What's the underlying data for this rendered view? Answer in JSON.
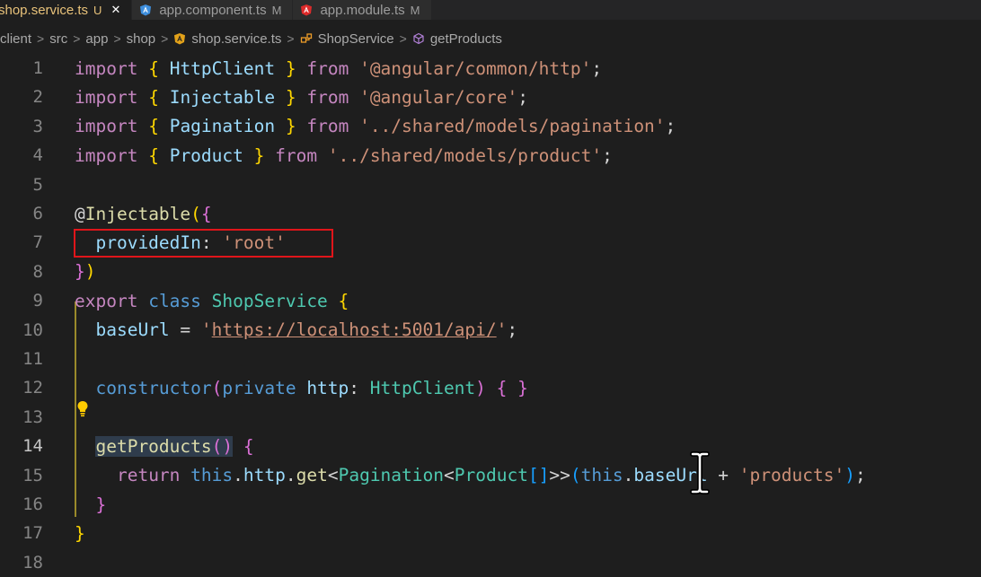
{
  "tabs": [
    {
      "label": "shop.service.ts",
      "status": "U",
      "active": true,
      "icon": "angular-service-icon"
    },
    {
      "label": "app.component.ts",
      "status": "M",
      "active": false,
      "icon": "angular-component-icon"
    },
    {
      "label": "app.module.ts",
      "status": "M",
      "active": false,
      "icon": "angular-module-icon"
    }
  ],
  "breadcrumb": {
    "items": [
      "client",
      "src",
      "app",
      "shop",
      "shop.service.ts",
      "ShopService",
      "getProducts"
    ]
  },
  "editor": {
    "current_line": 14,
    "lines": [
      {
        "n": "1",
        "tokens": [
          [
            "kwc",
            "import"
          ],
          [
            "t",
            " "
          ],
          [
            "br1",
            "{"
          ],
          [
            "t",
            " "
          ],
          [
            "var",
            "HttpClient"
          ],
          [
            "t",
            " "
          ],
          [
            "br1",
            "}"
          ],
          [
            "t",
            " "
          ],
          [
            "kwc",
            "from"
          ],
          [
            "t",
            " "
          ],
          [
            "str",
            "'@angular/common/http'"
          ],
          [
            "t",
            ";"
          ]
        ]
      },
      {
        "n": "2",
        "tokens": [
          [
            "kwc",
            "import"
          ],
          [
            "t",
            " "
          ],
          [
            "br1",
            "{"
          ],
          [
            "t",
            " "
          ],
          [
            "var",
            "Injectable"
          ],
          [
            "t",
            " "
          ],
          [
            "br1",
            "}"
          ],
          [
            "t",
            " "
          ],
          [
            "kwc",
            "from"
          ],
          [
            "t",
            " "
          ],
          [
            "str",
            "'@angular/core'"
          ],
          [
            "t",
            ";"
          ]
        ]
      },
      {
        "n": "3",
        "tokens": [
          [
            "kwc",
            "import"
          ],
          [
            "t",
            " "
          ],
          [
            "br1",
            "{"
          ],
          [
            "t",
            " "
          ],
          [
            "var",
            "Pagination"
          ],
          [
            "t",
            " "
          ],
          [
            "br1",
            "}"
          ],
          [
            "t",
            " "
          ],
          [
            "kwc",
            "from"
          ],
          [
            "t",
            " "
          ],
          [
            "str",
            "'../shared/models/pagination'"
          ],
          [
            "t",
            ";"
          ]
        ]
      },
      {
        "n": "4",
        "tokens": [
          [
            "kwc",
            "import"
          ],
          [
            "t",
            " "
          ],
          [
            "br1",
            "{"
          ],
          [
            "t",
            " "
          ],
          [
            "var",
            "Product"
          ],
          [
            "t",
            " "
          ],
          [
            "br1",
            "}"
          ],
          [
            "t",
            " "
          ],
          [
            "kwc",
            "from"
          ],
          [
            "t",
            " "
          ],
          [
            "str",
            "'../shared/models/product'"
          ],
          [
            "t",
            ";"
          ]
        ]
      },
      {
        "n": "5",
        "tokens": []
      },
      {
        "n": "6",
        "tokens": [
          [
            "t",
            "@"
          ],
          [
            "fn",
            "Injectable"
          ],
          [
            "br1",
            "("
          ],
          [
            "br2",
            "{"
          ]
        ]
      },
      {
        "n": "7",
        "tokens": [
          [
            "t",
            "  "
          ],
          [
            "var",
            "providedIn"
          ],
          [
            "t",
            ": "
          ],
          [
            "str",
            "'root'"
          ]
        ]
      },
      {
        "n": "8",
        "tokens": [
          [
            "br2",
            "}"
          ],
          [
            "br1",
            ")"
          ]
        ]
      },
      {
        "n": "9",
        "tokens": [
          [
            "kwc",
            "export"
          ],
          [
            "t",
            " "
          ],
          [
            "kw",
            "class"
          ],
          [
            "t",
            " "
          ],
          [
            "cls",
            "ShopService"
          ],
          [
            "t",
            " "
          ],
          [
            "br1",
            "{"
          ]
        ]
      },
      {
        "n": "10",
        "tokens": [
          [
            "t",
            "  "
          ],
          [
            "var",
            "baseUrl"
          ],
          [
            "t",
            " = "
          ],
          [
            "str",
            "'"
          ],
          [
            "strlink",
            "https://localhost:5001/api/"
          ],
          [
            "str",
            "'"
          ],
          [
            "t",
            ";"
          ]
        ]
      },
      {
        "n": "11",
        "tokens": []
      },
      {
        "n": "12",
        "tokens": [
          [
            "t",
            "  "
          ],
          [
            "kw",
            "constructor"
          ],
          [
            "br2",
            "("
          ],
          [
            "kw",
            "private"
          ],
          [
            "t",
            " "
          ],
          [
            "var",
            "http"
          ],
          [
            "t",
            ": "
          ],
          [
            "cls",
            "HttpClient"
          ],
          [
            "br2",
            ")"
          ],
          [
            "t",
            " "
          ],
          [
            "br2",
            "{"
          ],
          [
            "t",
            " "
          ],
          [
            "br2",
            "}"
          ]
        ]
      },
      {
        "n": "13",
        "tokens": []
      },
      {
        "n": "14",
        "tokens": [
          [
            "t",
            "  "
          ],
          [
            "fnhl",
            "getProducts"
          ],
          [
            "br2hl",
            "()"
          ],
          [
            "t",
            " "
          ],
          [
            "br2",
            "{"
          ]
        ]
      },
      {
        "n": "15",
        "tokens": [
          [
            "t",
            "    "
          ],
          [
            "kwc",
            "return"
          ],
          [
            "t",
            " "
          ],
          [
            "kw",
            "this"
          ],
          [
            "t",
            "."
          ],
          [
            "var",
            "http"
          ],
          [
            "t",
            "."
          ],
          [
            "fn",
            "get"
          ],
          [
            "t",
            "<"
          ],
          [
            "cls",
            "Pagination"
          ],
          [
            "t",
            "<"
          ],
          [
            "cls",
            "Product"
          ],
          [
            "br3",
            "[]"
          ],
          [
            "t",
            ">>"
          ],
          [
            "br3",
            "("
          ],
          [
            "kw",
            "this"
          ],
          [
            "t",
            "."
          ],
          [
            "var",
            "baseUrl"
          ],
          [
            "t",
            " + "
          ],
          [
            "str",
            "'products'"
          ],
          [
            "br3",
            ")"
          ],
          [
            "t",
            ";"
          ]
        ]
      },
      {
        "n": "16",
        "tokens": [
          [
            "t",
            "  "
          ],
          [
            "br2",
            "}"
          ]
        ]
      },
      {
        "n": "17",
        "tokens": [
          [
            "br1",
            "}"
          ]
        ]
      },
      {
        "n": "18",
        "tokens": []
      }
    ]
  },
  "colors": {
    "highlight_box": "#e0151a",
    "editor_bg": "#1e1e1e"
  }
}
